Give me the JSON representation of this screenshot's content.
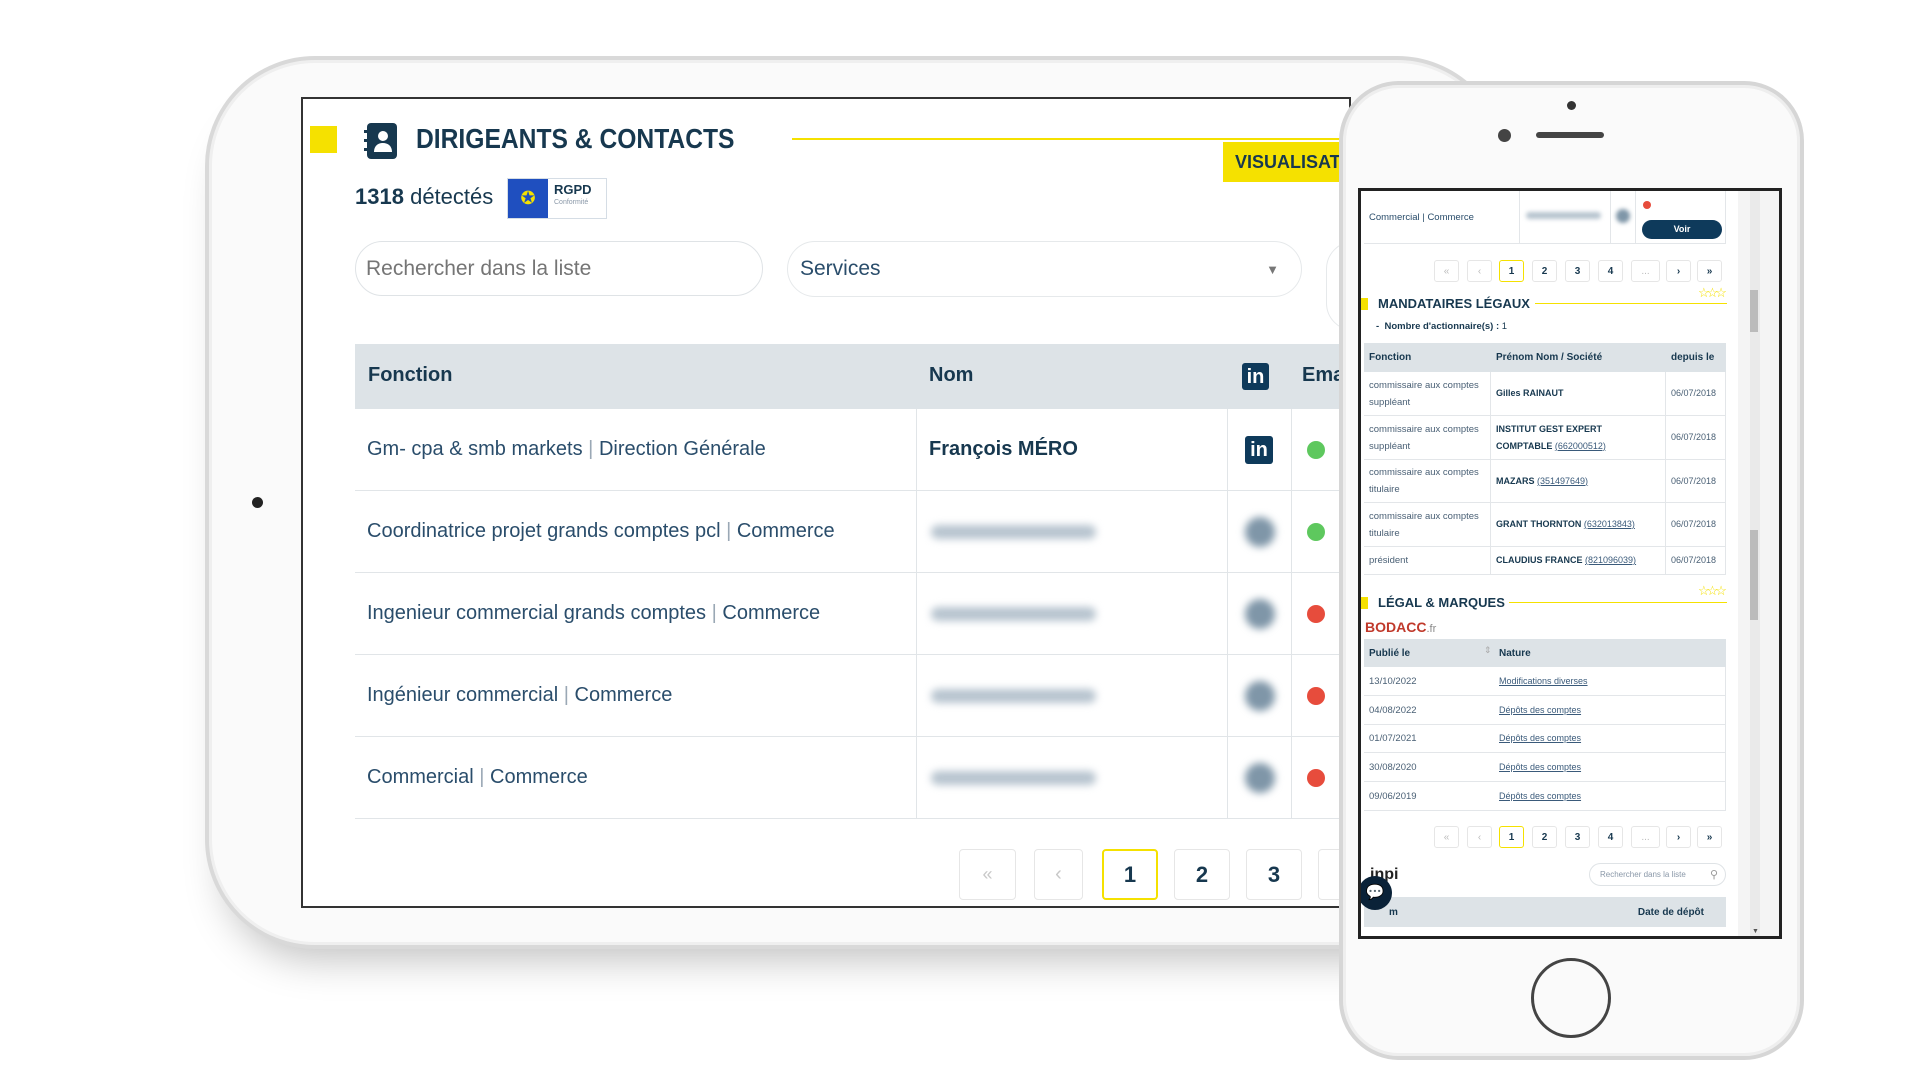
{
  "tablet": {
    "section_title": "DIRIGEANTS & CONTACTS",
    "visualise_button": "VISUALISAT",
    "count": "1318",
    "count_suffix": "détectés",
    "rgpd_badge": {
      "title": "RGPD",
      "subtitle": "Conformité"
    },
    "search_placeholder": "Rechercher dans la liste",
    "services_select": "Services",
    "table": {
      "headers": [
        "Fonction",
        "Nom",
        "linkedin-icon",
        "Ema"
      ],
      "rows": [
        {
          "fonction": "Gm- cpa & smb markets",
          "service": "Direction Générale",
          "nom": "François MÉRO",
          "linkedin": true,
          "status": "green"
        },
        {
          "fonction": "Coordinatrice projet grands comptes pcl",
          "service": "Commerce",
          "nom": "",
          "status": "green"
        },
        {
          "fonction": "Ingenieur commercial grands comptes",
          "service": "Commerce",
          "nom": "",
          "status": "red"
        },
        {
          "fonction": "Ingénieur commercial",
          "service": "Commerce",
          "nom": "",
          "status": "red"
        },
        {
          "fonction": "Commercial",
          "service": "Commerce",
          "nom": "",
          "status": "red"
        }
      ]
    },
    "pagination": {
      "first": "«",
      "prev": "‹",
      "pages": [
        "1",
        "2",
        "3"
      ],
      "current": "1"
    }
  },
  "phone": {
    "top_row": {
      "fonction": "Commercial",
      "service": "Commerce",
      "button": "Voir",
      "status": "red"
    },
    "pagination": {
      "first": "«",
      "prev": "‹",
      "pages": [
        "1",
        "2",
        "3",
        "4",
        "..."
      ],
      "next": "›",
      "last": "»",
      "current": "1"
    },
    "mandataires": {
      "title": "MANDATAIRES LÉGAUX",
      "actionnaires_label": "Nombre d'actionnaire(s) :",
      "actionnaires_value": "1",
      "headers": [
        "Fonction",
        "Prénom Nom / Société",
        "depuis le"
      ],
      "rows": [
        {
          "fonction": "commissaire aux comptes suppléant",
          "nom": "Gilles RAINAUT",
          "siren": "",
          "date": "06/07/2018"
        },
        {
          "fonction": "commissaire aux comptes suppléant",
          "nom": "INSTITUT GEST EXPERT COMPTABLE",
          "siren": "(662000512)",
          "date": "06/07/2018"
        },
        {
          "fonction": "commissaire aux comptes titulaire",
          "nom": "MAZARS",
          "siren": "(351497649)",
          "date": "06/07/2018"
        },
        {
          "fonction": "commissaire aux comptes titulaire",
          "nom": "GRANT THORNTON",
          "siren": "(632013843)",
          "date": "06/07/2018"
        },
        {
          "fonction": "président",
          "nom": "CLAUDIUS FRANCE",
          "siren": "(821096039)",
          "date": "06/07/2018"
        }
      ]
    },
    "legal": {
      "title": "LÉGAL & MARQUES",
      "bodacc_logo": "BODACC",
      "bodacc_suffix": ".fr",
      "headers": [
        "Publié le",
        "Nature"
      ],
      "rows": [
        {
          "date": "13/10/2022",
          "nature": "Modifications diverses"
        },
        {
          "date": "04/08/2022",
          "nature": "Dépôts des comptes"
        },
        {
          "date": "01/07/2021",
          "nature": "Dépôts des comptes"
        },
        {
          "date": "30/08/2020",
          "nature": "Dépôts des comptes"
        },
        {
          "date": "09/06/2019",
          "nature": "Dépôts des comptes"
        }
      ]
    },
    "inpi": {
      "logo": "inpi",
      "search_placeholder": "Rechercher dans la liste",
      "headers": [
        "m",
        "Date de dépôt"
      ]
    }
  },
  "colors": {
    "accent_yellow": "#f5e100",
    "navy": "#17384f",
    "header_gray": "#dde3e7",
    "status_green": "#5ec85e",
    "status_red": "#e74c3c",
    "bodacc_red": "#c0392b",
    "linkedin": "#0e3a5b"
  }
}
